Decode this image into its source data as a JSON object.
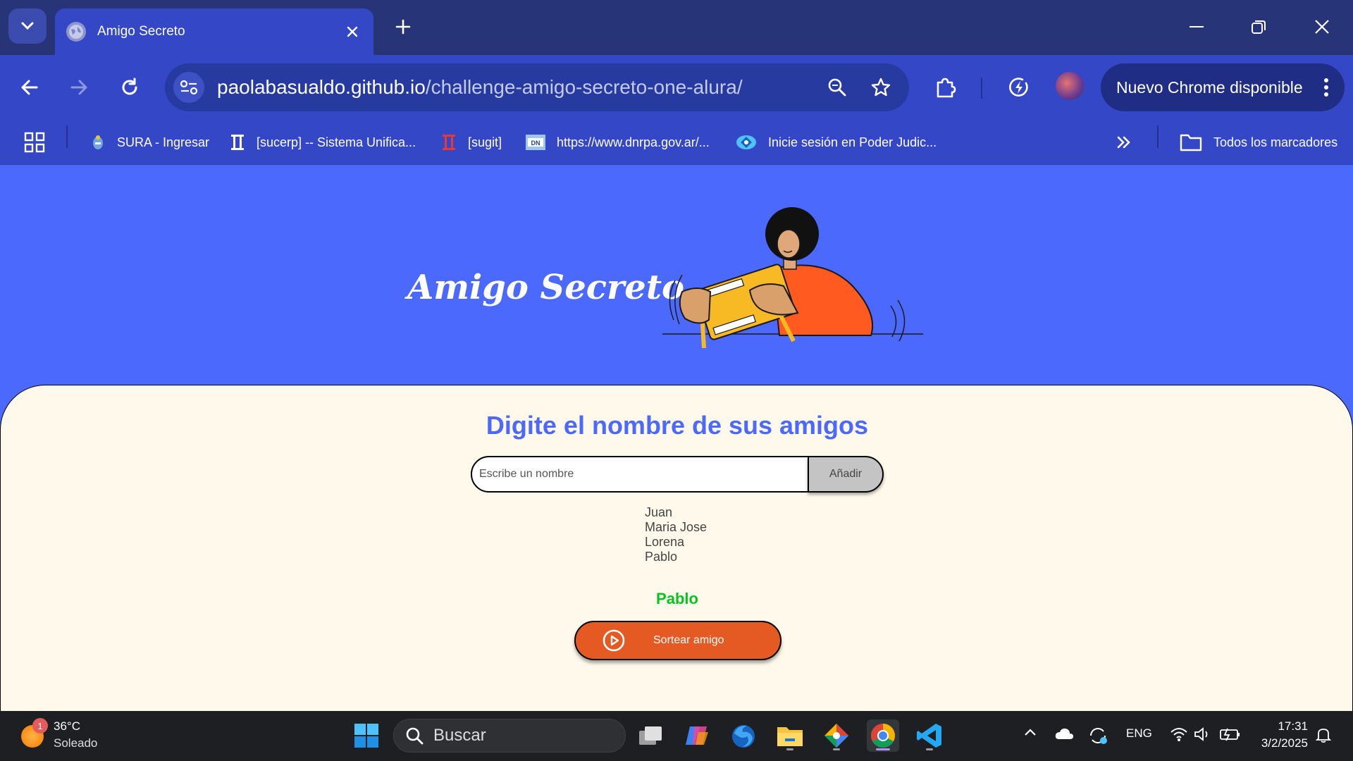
{
  "browser": {
    "tab": {
      "title": "Amigo Secreto"
    },
    "address": {
      "domain": "paolabasualdo.github.io",
      "path": "/challenge-amigo-secreto-one-alura/"
    },
    "update_label": "Nuevo Chrome disponible",
    "bookmarks": [
      {
        "label": "SURA - Ingresar",
        "icon": "sura-icon"
      },
      {
        "label": "[sucerp] -- Sistema Unifica...",
        "icon": "pillar-icon"
      },
      {
        "label": "[sugit]",
        "icon": "pillar-red-icon"
      },
      {
        "label": "https://www.dnrpa.gov.ar/...",
        "icon": "dnrpa-icon"
      },
      {
        "label": "Inicie sesión en Poder Judic...",
        "icon": "judicial-icon"
      }
    ],
    "all_bookmarks_label": "Todos los marcadores"
  },
  "page": {
    "hero_title": "Amigo Secreto",
    "heading": "Digite el nombre de sus amigos",
    "input": {
      "placeholder": "Escribe un nombre",
      "value": ""
    },
    "add_label": "Añadir",
    "friends": [
      "Juan",
      "Maria Jose",
      "Lorena",
      "Pablo"
    ],
    "result": "Pablo",
    "draw_label": "Sortear amigo",
    "colors": {
      "background": "#4b69fd",
      "card": "#fff9eb",
      "accent": "#e45a22",
      "result": "#05c41f"
    }
  },
  "taskbar": {
    "weather": {
      "temp": "36°C",
      "desc": "Soleado",
      "badge": "1"
    },
    "search_label": "Buscar",
    "language": "ENG",
    "time": "17:31",
    "date": "3/2/2025"
  }
}
